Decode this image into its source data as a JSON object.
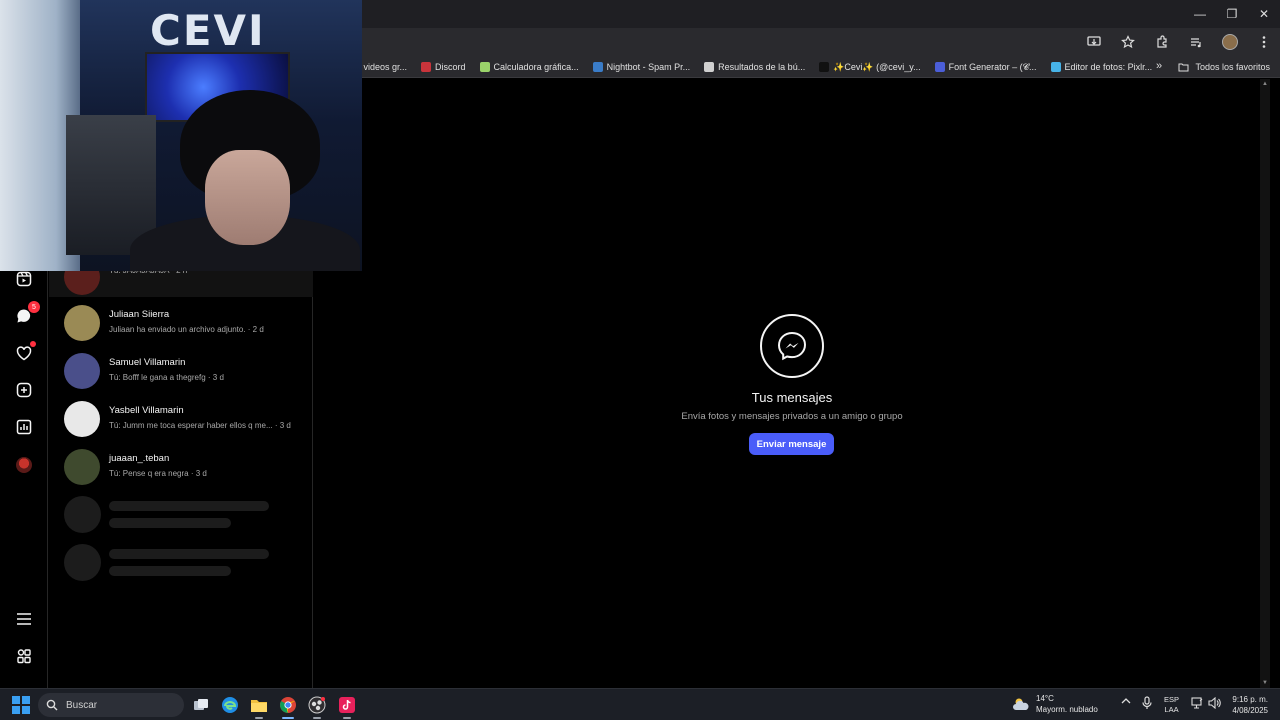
{
  "window": {
    "controls": {
      "minimize": "—",
      "restore": "❐",
      "close": "✕"
    }
  },
  "bookmarks": {
    "items": [
      {
        "label": "r videos gr...",
        "color": "#6b6b6b"
      },
      {
        "label": "Discord",
        "color": "#c8343b"
      },
      {
        "label": "Calculadora gráfica...",
        "color": "#9ad36a"
      },
      {
        "label": "Nightbot - Spam Pr...",
        "color": "#3a7cc8"
      },
      {
        "label": "Resultados de la bú...",
        "color": "#d0d0d0"
      },
      {
        "label": "✨Cevi✨ (@cevi_y...",
        "color": "#111111"
      },
      {
        "label": "Font Generator – (𝓒...",
        "color": "#4b5ed8"
      },
      {
        "label": "Editor de fotos: Pixlr...",
        "color": "#47b3e8"
      }
    ],
    "more_glyph": "»",
    "all_label": "Todos los favoritos"
  },
  "rail": {
    "messages_badge": "5"
  },
  "conversations": [
    {
      "name": "",
      "meta": "Tú: JAJAJAJAJA · 2 h",
      "avatar_color": "#5b1f1c"
    },
    {
      "name": "Juliaan Siierra",
      "meta": "Juliaan ha enviado un archivo adjunto. · 2 d",
      "avatar_color": "#9a8a55"
    },
    {
      "name": "Samuel Villamarin",
      "meta": "Tú: Bofff le gana a thegrefg · 3 d",
      "avatar_color": "#4a4f8a"
    },
    {
      "name": "Yasbell Villamarin",
      "meta": "Tú: Jumm me toca esperar haber ellos q me... · 3 d",
      "avatar_color": "#e8e8e8"
    },
    {
      "name": "juaaan_.teban",
      "meta": "Tú: Pense q era negra · 3 d",
      "avatar_color": "#3f4a2e"
    }
  ],
  "empty_state": {
    "title": "Tus mensajes",
    "subtitle": "Envía fotos y mensajes privados a un amigo o grupo",
    "button": "Enviar mensaje"
  },
  "webcam": {
    "sign_text": "CEVI"
  },
  "taskbar": {
    "search_placeholder": "Buscar",
    "weather_temp": "14°C",
    "weather_desc": "Mayorm. nublado",
    "lang_top": "ESP",
    "lang_bottom": "LAA",
    "time": "9:16 p. m.",
    "date": "4/08/2025"
  },
  "colors": {
    "accent_button": "#4a5df9",
    "badge": "#ff3040"
  }
}
